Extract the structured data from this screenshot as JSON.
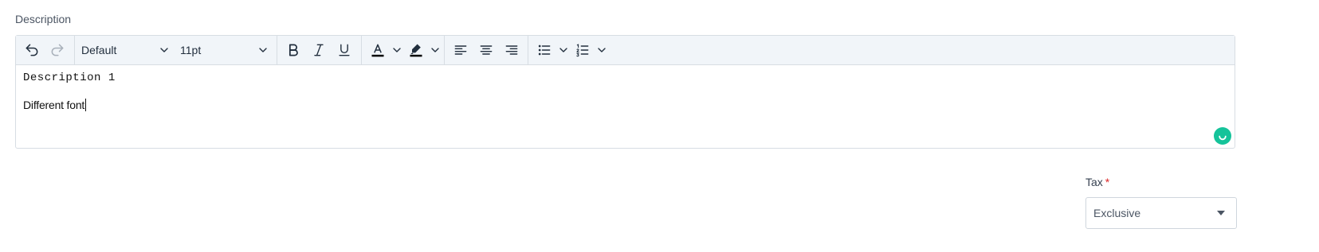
{
  "description": {
    "label": "Description",
    "toolbar": {
      "undo_icon": "undo-icon",
      "redo_icon": "redo-icon",
      "font_family": "Default",
      "font_size": "11pt",
      "bold_icon": "bold-icon",
      "italic_icon": "italic-icon",
      "underline_icon": "underline-icon",
      "text_color_icon": "text-color-icon",
      "highlight_icon": "highlight-icon",
      "align_left_icon": "align-left-icon",
      "align_center_icon": "align-center-icon",
      "align_right_icon": "align-right-icon",
      "bullet_list_icon": "bullet-list-icon",
      "numbered_list_icon": "numbered-list-icon"
    },
    "content": {
      "line1": "Description 1",
      "line2": "Different font"
    },
    "grammar_button_color": "#15c39a"
  },
  "tax": {
    "label": "Tax",
    "required_mark": "*",
    "selected": "Exclusive"
  }
}
